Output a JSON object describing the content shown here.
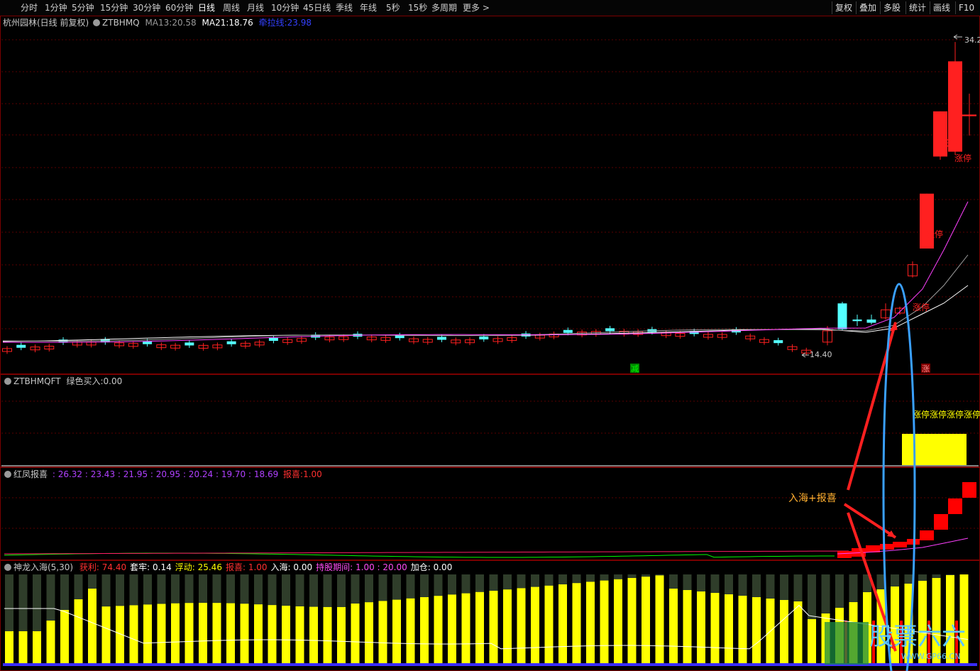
{
  "toolbar": {
    "periods": [
      "分时",
      "1分钟",
      "5分钟",
      "15分钟",
      "30分钟",
      "60分钟",
      "日线",
      "周线",
      "月线",
      "10分钟",
      "45日线",
      "季线",
      "年线",
      "5秒",
      "15秒",
      "多周期",
      "更多 >"
    ],
    "active": "日线",
    "right_buttons": [
      "复权",
      "叠加",
      "多股",
      "统计",
      "画线",
      "F10"
    ]
  },
  "main_chart": {
    "stock_name": "杭州园林(日线 前复权)",
    "indicator": "ZTBHMQ",
    "ma13_label": "MA13:",
    "ma13_value": "20.58",
    "ma21_label": "MA21:",
    "ma21_value": "18.76",
    "line3_label": "牵拉线:",
    "line3_value": "23.98",
    "high_label": "34.2",
    "low_label": "14.40",
    "limit_label": "涨停",
    "marker_jian": "减",
    "marker_zhang": "涨",
    "colors": {
      "up": "#ff2020",
      "down": "#54ffff",
      "ma13": "#ff40ff",
      "ma21": "#a0a0a0",
      "line3": "#ffffff",
      "border": "#7a0000",
      "grid": "#5a0000"
    }
  },
  "panel2": {
    "name": "ZTBHMQFT",
    "label": "绿色买入:",
    "value": "0.00",
    "limit_text": "涨停涨停涨停涨停"
  },
  "panel3": {
    "name": "红凤报喜",
    "values_text": ": 26.32 : 23.43 : 21.95 : 20.95 : 20.24 : 19.70 : 18.69",
    "baoxi_label": "报喜:",
    "baoxi_value": "1.00",
    "annotation": "入海+报喜"
  },
  "panel4": {
    "name": "神龙入海(5,30)",
    "items": [
      {
        "label": "获利:",
        "value": "74.40",
        "color": "#ff3030",
        "vcolor": "#ff3030"
      },
      {
        "label": "套牢:",
        "value": "0.14",
        "color": "#ffffff",
        "vcolor": "#ffffff"
      },
      {
        "label": "浮动:",
        "value": "25.46",
        "color": "#ffff00",
        "vcolor": "#ffff00"
      },
      {
        "label": "报喜:",
        "value": "1.00",
        "color": "#ff3030",
        "vcolor": "#ff3030"
      },
      {
        "label": "入海:",
        "value": "0.00",
        "color": "#ffffff",
        "vcolor": "#ffffff"
      },
      {
        "label": "持股期间:",
        "value": "1.00 : 20.00",
        "color": "#ff4df5",
        "vcolor": "#ff4df5"
      },
      {
        "label": "加仓:",
        "value": "0.00",
        "color": "#ffffff",
        "vcolor": "#ffffff"
      }
    ]
  },
  "watermark": {
    "brand": "股票六六",
    "url": "WWW.GP66.CN"
  }
}
